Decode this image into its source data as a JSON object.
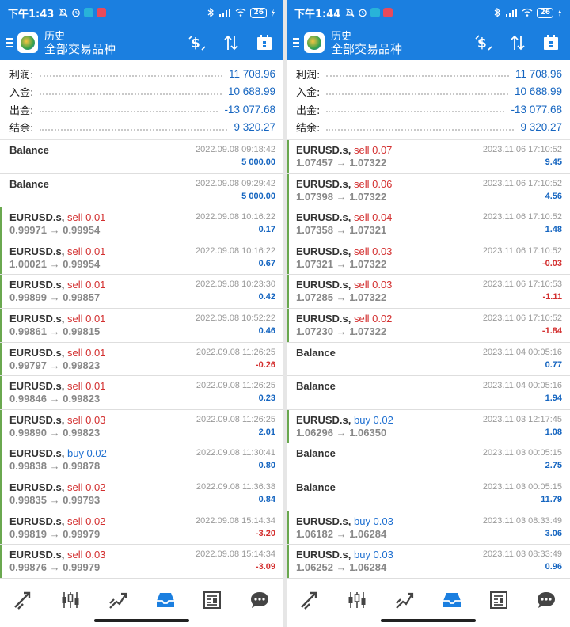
{
  "screens": [
    {
      "status": {
        "time": "下午1:43",
        "battery": "26"
      },
      "appbar": {
        "title": "历史",
        "subtitle": "全部交易品种"
      },
      "summary": [
        {
          "label": "利润:",
          "value": "11 708.96"
        },
        {
          "label": "入金:",
          "value": "10 688.99"
        },
        {
          "label": "出金:",
          "value": "-13 077.68"
        },
        {
          "label": "结余:",
          "value": "9 320.27"
        }
      ],
      "rows": [
        {
          "kind": "balance",
          "title": "Balance",
          "datetime": "2022.09.08 09:18:42",
          "pl": "5 000.00"
        },
        {
          "kind": "balance",
          "title": "Balance",
          "datetime": "2022.09.08 09:29:42",
          "pl": "5 000.00"
        },
        {
          "kind": "trade",
          "symbol": "EURUSD.s,",
          "side": "sell 0.01",
          "prices": "0.99971 → 0.99954",
          "datetime": "2022.09.08 10:16:22",
          "pl": "0.17"
        },
        {
          "kind": "trade",
          "symbol": "EURUSD.s,",
          "side": "sell 0.01",
          "prices": "1.00021 → 0.99954",
          "datetime": "2022.09.08 10:16:22",
          "pl": "0.67"
        },
        {
          "kind": "trade",
          "symbol": "EURUSD.s,",
          "side": "sell 0.01",
          "prices": "0.99899 → 0.99857",
          "datetime": "2022.09.08 10:23:30",
          "pl": "0.42"
        },
        {
          "kind": "trade",
          "symbol": "EURUSD.s,",
          "side": "sell 0.01",
          "prices": "0.99861 → 0.99815",
          "datetime": "2022.09.08 10:52:22",
          "pl": "0.46"
        },
        {
          "kind": "trade",
          "symbol": "EURUSD.s,",
          "side": "sell 0.01",
          "prices": "0.99797 → 0.99823",
          "datetime": "2022.09.08 11:26:25",
          "pl": "-0.26"
        },
        {
          "kind": "trade",
          "symbol": "EURUSD.s,",
          "side": "sell 0.01",
          "prices": "0.99846 → 0.99823",
          "datetime": "2022.09.08 11:26:25",
          "pl": "0.23"
        },
        {
          "kind": "trade",
          "symbol": "EURUSD.s,",
          "side": "sell 0.03",
          "prices": "0.99890 → 0.99823",
          "datetime": "2022.09.08 11:26:25",
          "pl": "2.01"
        },
        {
          "kind": "trade",
          "symbol": "EURUSD.s,",
          "side": "buy 0.02",
          "prices": "0.99838 → 0.99878",
          "datetime": "2022.09.08 11:30:41",
          "pl": "0.80"
        },
        {
          "kind": "trade",
          "symbol": "EURUSD.s,",
          "side": "sell 0.02",
          "prices": "0.99835 → 0.99793",
          "datetime": "2022.09.08 11:36:38",
          "pl": "0.84"
        },
        {
          "kind": "trade",
          "symbol": "EURUSD.s,",
          "side": "sell 0.02",
          "prices": "0.99819 → 0.99979",
          "datetime": "2022.09.08 15:14:34",
          "pl": "-3.20"
        },
        {
          "kind": "trade",
          "symbol": "EURUSD.s,",
          "side": "sell 0.03",
          "prices": "0.99876 → 0.99979",
          "datetime": "2022.09.08 15:14:34",
          "pl": "-3.09"
        }
      ]
    },
    {
      "status": {
        "time": "下午1:44",
        "battery": "26"
      },
      "appbar": {
        "title": "历史",
        "subtitle": "全部交易品种"
      },
      "summary": [
        {
          "label": "利润:",
          "value": "11 708.96"
        },
        {
          "label": "入金:",
          "value": "10 688.99"
        },
        {
          "label": "出金:",
          "value": "-13 077.68"
        },
        {
          "label": "结余:",
          "value": "9 320.27"
        }
      ],
      "rows": [
        {
          "kind": "trade",
          "symbol": "EURUSD.s,",
          "side": "sell 0.07",
          "prices": "1.07457 → 1.07322",
          "datetime": "2023.11.06 17:10:52",
          "pl": "9.45"
        },
        {
          "kind": "trade",
          "symbol": "EURUSD.s,",
          "side": "sell 0.06",
          "prices": "1.07398 → 1.07322",
          "datetime": "2023.11.06 17:10:52",
          "pl": "4.56"
        },
        {
          "kind": "trade",
          "symbol": "EURUSD.s,",
          "side": "sell 0.04",
          "prices": "1.07358 → 1.07321",
          "datetime": "2023.11.06 17:10:52",
          "pl": "1.48"
        },
        {
          "kind": "trade",
          "symbol": "EURUSD.s,",
          "side": "sell 0.03",
          "prices": "1.07321 → 1.07322",
          "datetime": "2023.11.06 17:10:52",
          "pl": "-0.03"
        },
        {
          "kind": "trade",
          "symbol": "EURUSD.s,",
          "side": "sell 0.03",
          "prices": "1.07285 → 1.07322",
          "datetime": "2023.11.06 17:10:53",
          "pl": "-1.11"
        },
        {
          "kind": "trade",
          "symbol": "EURUSD.s,",
          "side": "sell 0.02",
          "prices": "1.07230 → 1.07322",
          "datetime": "2023.11.06 17:10:52",
          "pl": "-1.84"
        },
        {
          "kind": "balance",
          "title": "Balance",
          "datetime": "2023.11.04 00:05:16",
          "pl": "0.77"
        },
        {
          "kind": "balance",
          "title": "Balance",
          "datetime": "2023.11.04 00:05:16",
          "pl": "1.94"
        },
        {
          "kind": "trade",
          "symbol": "EURUSD.s,",
          "side": "buy 0.02",
          "prices": "1.06296 → 1.06350",
          "datetime": "2023.11.03 12:17:45",
          "pl": "1.08"
        },
        {
          "kind": "balance",
          "title": "Balance",
          "datetime": "2023.11.03 00:05:15",
          "pl": "2.75"
        },
        {
          "kind": "balance",
          "title": "Balance",
          "datetime": "2023.11.03 00:05:15",
          "pl": "11.79"
        },
        {
          "kind": "trade",
          "symbol": "EURUSD.s,",
          "side": "buy 0.03",
          "prices": "1.06182 → 1.06284",
          "datetime": "2023.11.03 08:33:49",
          "pl": "3.06"
        },
        {
          "kind": "trade",
          "symbol": "EURUSD.s,",
          "side": "buy 0.03",
          "prices": "1.06252 → 1.06284",
          "datetime": "2023.11.03 08:33:49",
          "pl": "0.96"
        }
      ]
    }
  ],
  "tabs": [
    "quotes-icon",
    "chart-icon",
    "trade-icon",
    "history-icon",
    "news-icon",
    "messages-icon"
  ],
  "colors": {
    "accent": "#1b7fe0",
    "profit": "#1565c0",
    "loss": "#d32f2f",
    "trade_marker": "#6aa84f"
  }
}
